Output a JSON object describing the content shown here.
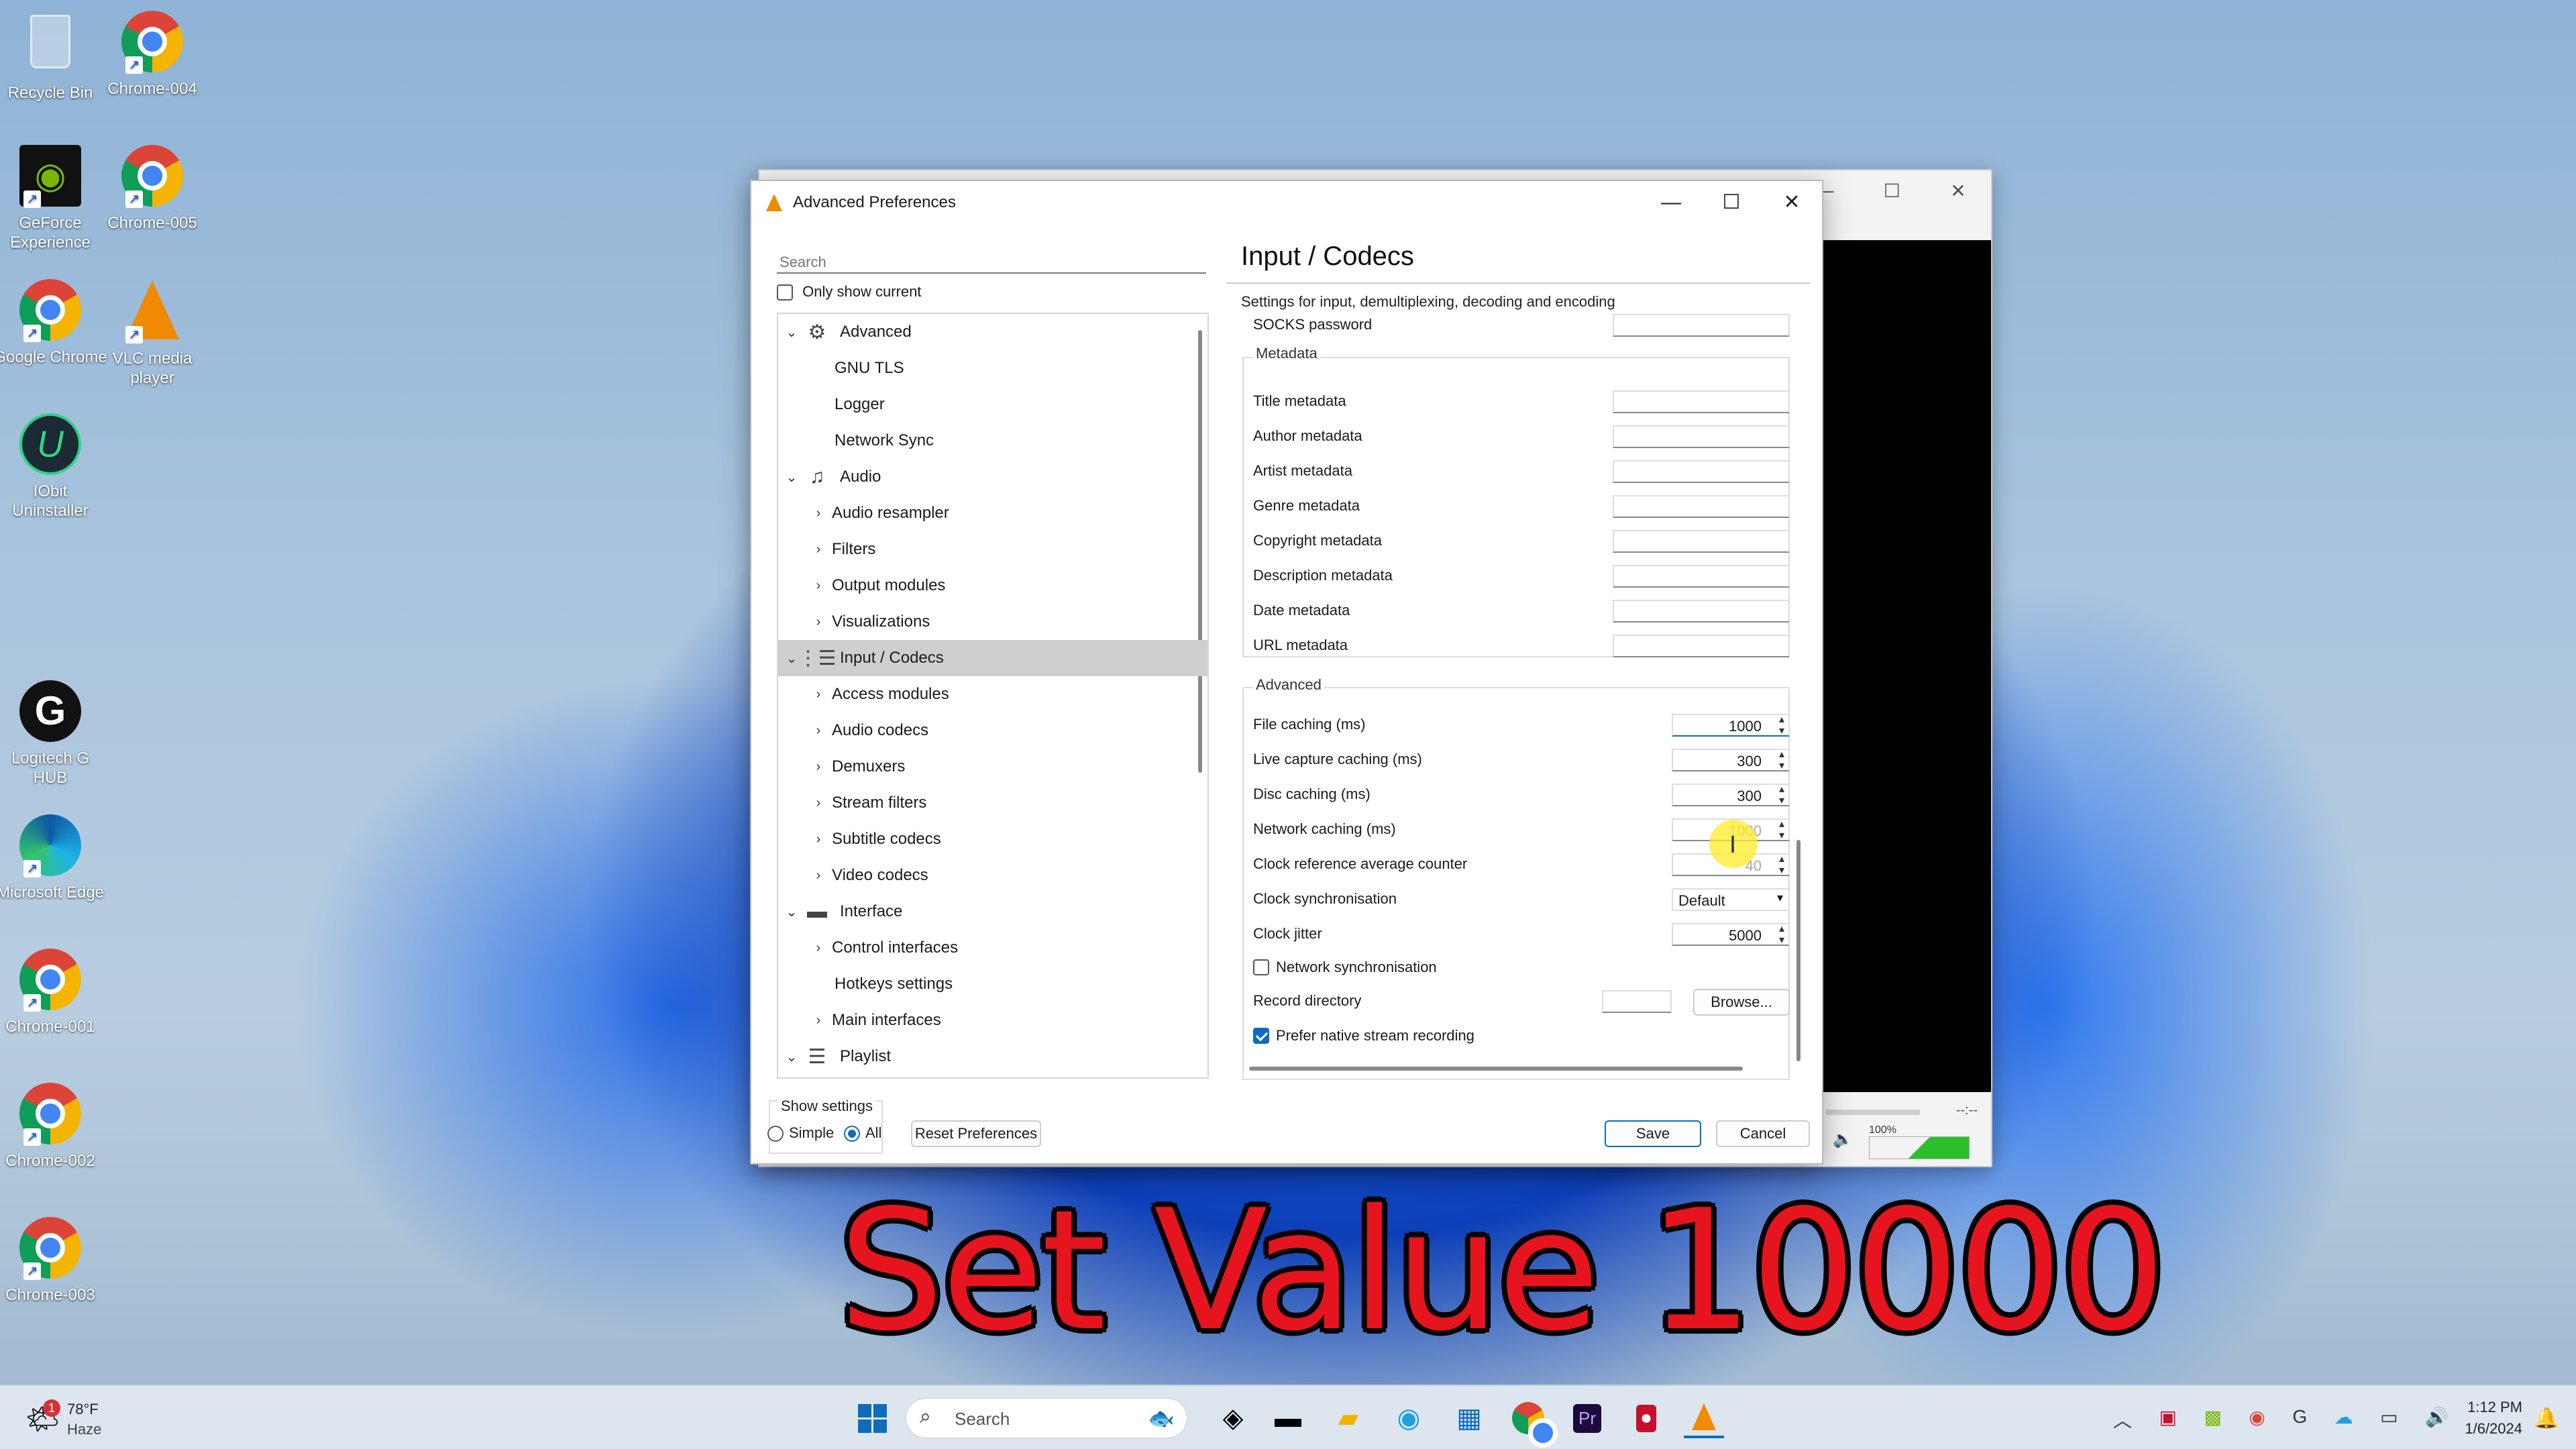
{
  "desktop": {
    "icons": [
      {
        "label": "Recycle Bin"
      },
      {
        "label": "Chrome-004"
      },
      {
        "label": "GeForce Experience"
      },
      {
        "label": "Chrome-005"
      },
      {
        "label": "Google Chrome"
      },
      {
        "label": "VLC media player"
      },
      {
        "label": "IObit Uninstaller"
      },
      {
        "label": "Logitech G HUB"
      },
      {
        "label": "Microsoft Edge"
      },
      {
        "label": "Chrome-001"
      },
      {
        "label": "Chrome-002"
      },
      {
        "label": "Chrome-003"
      }
    ]
  },
  "window": {
    "title": "Advanced Preferences",
    "minimize": "—",
    "maximize": "☐",
    "close": "✕"
  },
  "search": {
    "placeholder": "Search"
  },
  "only_show_current": "Only show current",
  "tree": [
    {
      "label": "Advanced",
      "expanded": true,
      "icon": "gear-icon"
    },
    {
      "label": "GNU TLS"
    },
    {
      "label": "Logger"
    },
    {
      "label": "Network Sync"
    },
    {
      "label": "Audio",
      "expanded": true,
      "icon": "music-icon"
    },
    {
      "label": "Audio resampler"
    },
    {
      "label": "Filters"
    },
    {
      "label": "Output modules"
    },
    {
      "label": "Visualizations"
    },
    {
      "label": "Input / Codecs",
      "expanded": true,
      "selected": true,
      "icon": "codecs-icon"
    },
    {
      "label": "Access modules"
    },
    {
      "label": "Audio codecs"
    },
    {
      "label": "Demuxers"
    },
    {
      "label": "Stream filters"
    },
    {
      "label": "Subtitle codecs"
    },
    {
      "label": "Video codecs"
    },
    {
      "label": "Interface",
      "expanded": true,
      "icon": "brush-icon"
    },
    {
      "label": "Control interfaces"
    },
    {
      "label": "Hotkeys settings"
    },
    {
      "label": "Main interfaces"
    },
    {
      "label": "Playlist",
      "expanded": true,
      "icon": "playlist-icon"
    }
  ],
  "panel": {
    "title": "Input / Codecs",
    "subtitle": "Settings for input, demultiplexing, decoding and encoding",
    "socks_password": "SOCKS password",
    "metadata_group": "Metadata",
    "metadata": [
      "Title metadata",
      "Author metadata",
      "Artist metadata",
      "Genre metadata",
      "Copyright metadata",
      "Description metadata",
      "Date metadata",
      "URL metadata"
    ],
    "advanced_group": "Advanced",
    "file_caching": {
      "label": "File caching (ms)",
      "value": "1000"
    },
    "live_caching": {
      "label": "Live capture caching (ms)",
      "value": "300"
    },
    "disc_caching": {
      "label": "Disc caching (ms)",
      "value": "300"
    },
    "network_caching": {
      "label": "Network caching (ms)",
      "value": "1000"
    },
    "clock_ref": {
      "label": "Clock reference average counter",
      "value": "40"
    },
    "clock_sync": {
      "label": "Clock synchronisation",
      "value": "Default"
    },
    "clock_jitter": {
      "label": "Clock jitter",
      "value": "5000"
    },
    "network_sync": "Network synchronisation",
    "record_dir": "Record directory",
    "browse": "Browse...",
    "prefer_native": "Prefer native stream recording"
  },
  "footer": {
    "show_settings": "Show settings",
    "simple": "Simple",
    "all": "All",
    "reset": "Reset Preferences",
    "save": "Save",
    "cancel": "Cancel"
  },
  "player": {
    "volume": "100%",
    "time": "--:--"
  },
  "overlay": "Set Value 10000",
  "taskbar": {
    "weather_temp": "78°F",
    "weather_desc": "Haze",
    "weather_badge": "1",
    "search": "Search",
    "time": "1:12 PM",
    "date": "1/6/2024"
  }
}
